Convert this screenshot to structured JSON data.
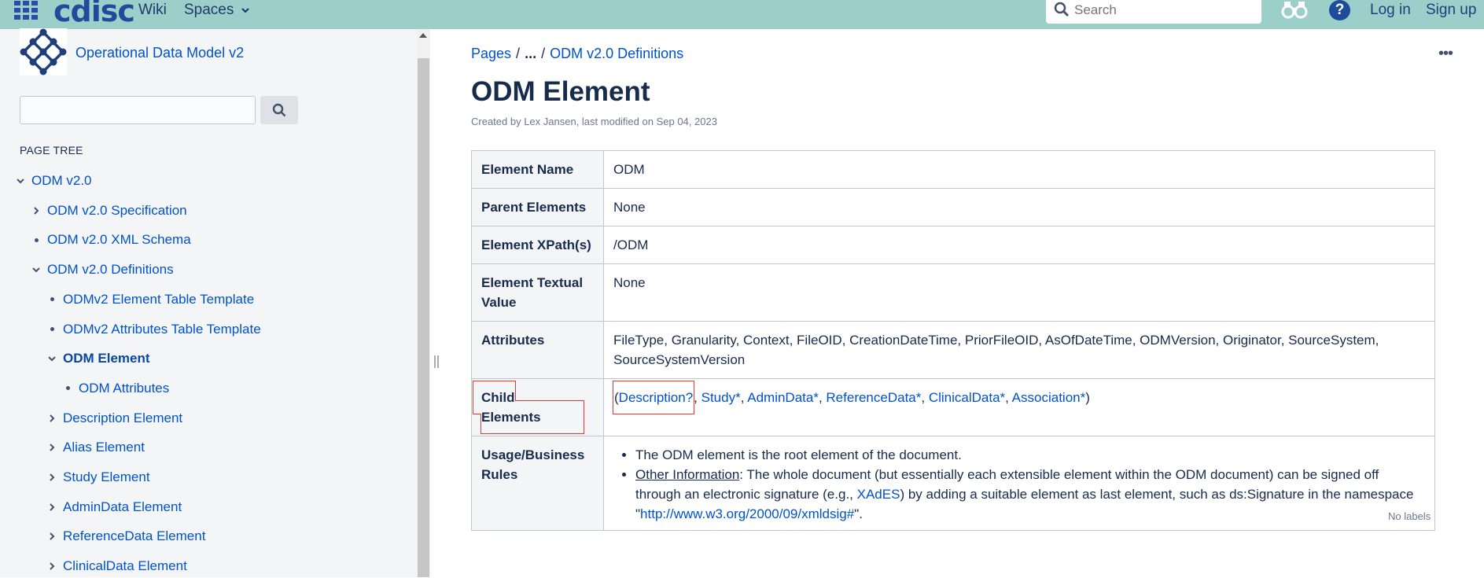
{
  "topbar": {
    "logo": "cdisc",
    "nav": [
      {
        "label": "Wiki"
      },
      {
        "label": "Spaces"
      }
    ],
    "search_placeholder": "Search",
    "help_glyph": "?",
    "login": "Log in",
    "signup": "Sign up"
  },
  "sidebar": {
    "space_title": "Operational Data Model v2",
    "page_tree_heading": "PAGE TREE",
    "tree": [
      {
        "label": "ODM v2.0",
        "state": "expanded",
        "depth": 0
      },
      {
        "label": "ODM v2.0 Specification",
        "state": "collapsed",
        "depth": 1
      },
      {
        "label": "ODM v2.0 XML Schema",
        "state": "leaf",
        "depth": 1
      },
      {
        "label": "ODM v2.0 Definitions",
        "state": "expanded",
        "depth": 1
      },
      {
        "label": "ODMv2 Element Table Template",
        "state": "leaf",
        "depth": 2
      },
      {
        "label": "ODMv2 Attributes Table Template",
        "state": "leaf",
        "depth": 2
      },
      {
        "label": "ODM Element",
        "state": "expanded",
        "depth": 2,
        "current": true
      },
      {
        "label": "ODM Attributes",
        "state": "leaf",
        "depth": 3
      },
      {
        "label": "Description Element",
        "state": "collapsed",
        "depth": 2
      },
      {
        "label": "Alias Element",
        "state": "collapsed",
        "depth": 2
      },
      {
        "label": "Study Element",
        "state": "collapsed",
        "depth": 2
      },
      {
        "label": "AdminData Element",
        "state": "collapsed",
        "depth": 2
      },
      {
        "label": "ReferenceData Element",
        "state": "collapsed",
        "depth": 2
      },
      {
        "label": "ClinicalData Element",
        "state": "collapsed",
        "depth": 2
      }
    ]
  },
  "main": {
    "breadcrumbs": [
      "Pages",
      "...",
      "ODM v2.0 Definitions"
    ],
    "more_glyph": "•••",
    "title": "ODM Element",
    "byline": "Created by Lex Jansen, last modified on Sep 04, 2023",
    "table": {
      "element_name": {
        "label": "Element Name",
        "value": "ODM"
      },
      "parent_elements": {
        "label": "Parent Elements",
        "value": "None"
      },
      "xpath": {
        "label": "Element XPath(s)",
        "value": "/ODM"
      },
      "textual_value": {
        "label": "Element Textual Value",
        "value": "None"
      },
      "attributes": {
        "label": "Attributes",
        "value": "FileType, Granularity, Context, FileOID, CreationDateTime, PriorFileOID, AsOfDateTime, ODMVersion, Originator, SourceSystem, SourceSystemVersion"
      },
      "child_elements": {
        "label": "Child Elements",
        "open": "(",
        "items": [
          {
            "link": "Description",
            "suffix": "?"
          },
          {
            "link": "Study",
            "suffix": "*"
          },
          {
            "link": "AdminData",
            "suffix": "*"
          },
          {
            "link": "ReferenceData",
            "suffix": "*"
          },
          {
            "link": "ClinicalData",
            "suffix": "*"
          },
          {
            "link": "Association",
            "suffix": "*"
          }
        ],
        "close": ")"
      },
      "usage": {
        "label": "Usage/Business Rules",
        "rule1": "The ODM element is the root element of the document.",
        "rule2_term": "Other Information",
        "rule2_a": ": The whole document (but essentially each extensible element within the ODM document) can be signed off through an electronic signature (e.g., ",
        "rule2_link": "XAdES",
        "rule2_b": ") by adding a suitable element as last element, such as ds:Signature in the namespace \"",
        "rule2_url": "http://www.w3.org/2000/09/xmldsig#",
        "rule2_c": "\"."
      }
    },
    "labels": "No labels"
  }
}
